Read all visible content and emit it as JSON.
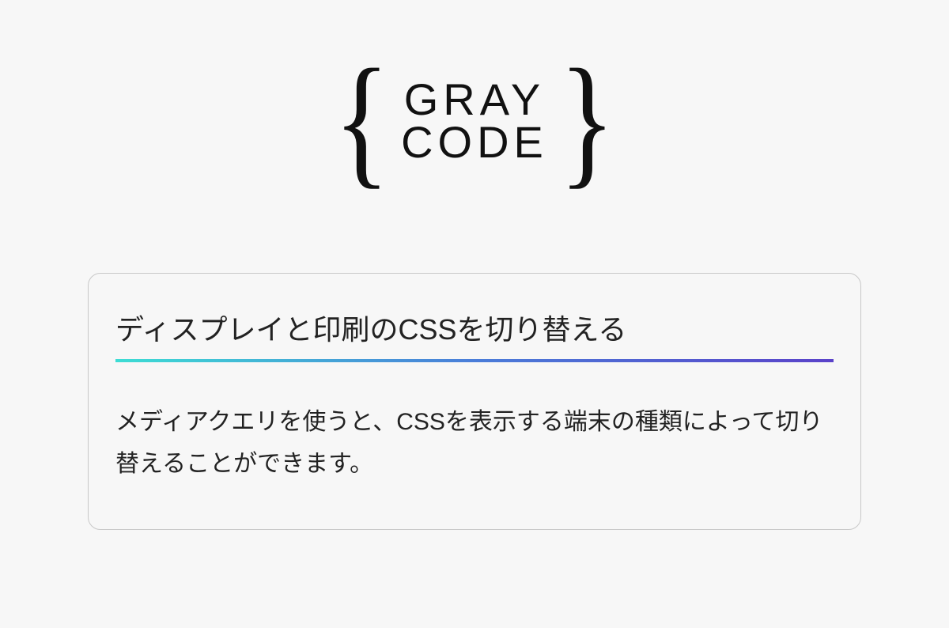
{
  "logo": {
    "line1": "GRAY",
    "line2": "CODE"
  },
  "card": {
    "title": "ディスプレイと印刷のCSSを切り替える",
    "body": "メディアクエリを使うと、CSSを表示する端末の種類によって切り替えることができます。"
  }
}
